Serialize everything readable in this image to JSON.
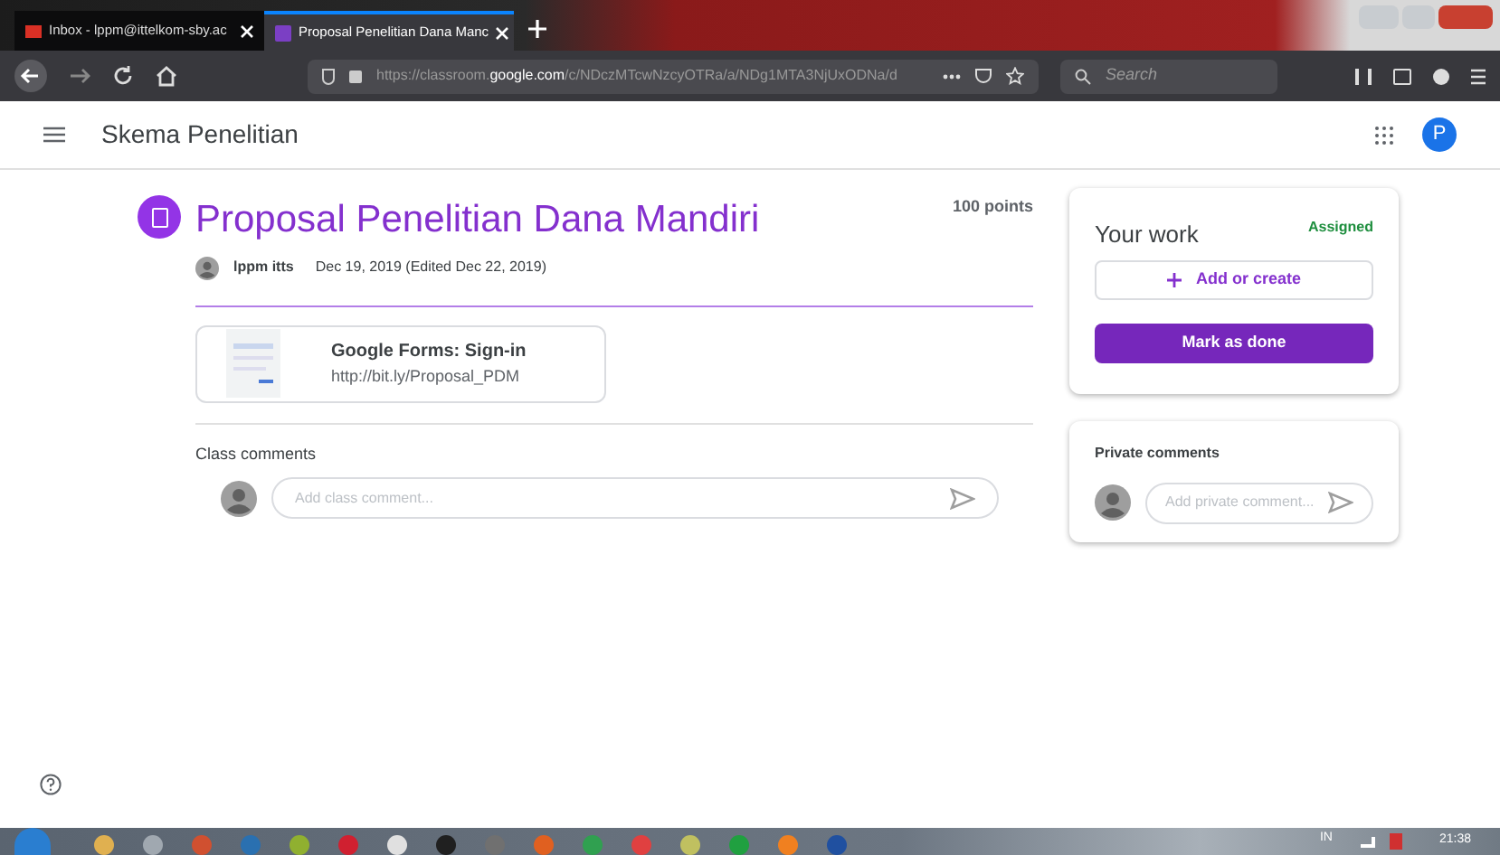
{
  "browser": {
    "tabs": [
      {
        "label": "Inbox - lppm@ittelkom-sby.ac",
        "kind": "mail",
        "selected": false
      },
      {
        "label": "Proposal Penelitian Dana Manc",
        "kind": "classroom",
        "selected": true
      }
    ],
    "url": "https://classroom.**google.com**/c/NDczMTcwNzcyOTRa/a/NDg1MTA3NjUxODNa/d",
    "search": {
      "placeholder": "Search"
    }
  },
  "header": {
    "title": "Skema Penelitian",
    "avatar": "P"
  },
  "assignment": {
    "title": "Proposal Penelitian Dana Mandiri",
    "points": "100 points",
    "author": "lppm itts",
    "date": "Dec 19, 2019 (Edited Dec 22, 2019)",
    "attachment": {
      "title": "Google Forms: Sign-in",
      "url": "http://bit.ly/Proposal_PDM"
    },
    "class_comments": {
      "label": "Class comments",
      "placeholder": "Add class comment..."
    }
  },
  "your_work": {
    "title": "Your work",
    "status": "Assigned",
    "add_button": "Add or create",
    "done_button": "Mark as done"
  },
  "private_comments": {
    "label": "Private comments",
    "placeholder": "Add private comment..."
  },
  "taskbar": {
    "apps": [
      {
        "color": "#e0b050"
      },
      {
        "color": "#a0a8b0"
      },
      {
        "color": "#d05030"
      },
      {
        "color": "#2a70b0"
      },
      {
        "color": "#90b030"
      },
      {
        "color": "#d02030"
      },
      {
        "color": "#e0e0e0"
      },
      {
        "color": "#202020"
      },
      {
        "color": "#707070"
      },
      {
        "color": "#e06020"
      },
      {
        "color": "#30a050"
      },
      {
        "color": "#e04040"
      },
      {
        "color": "#c0c060"
      },
      {
        "color": "#20a040"
      },
      {
        "color": "#f08020"
      },
      {
        "color": "#2050a0"
      }
    ],
    "language": "IN",
    "time": "21:38"
  }
}
